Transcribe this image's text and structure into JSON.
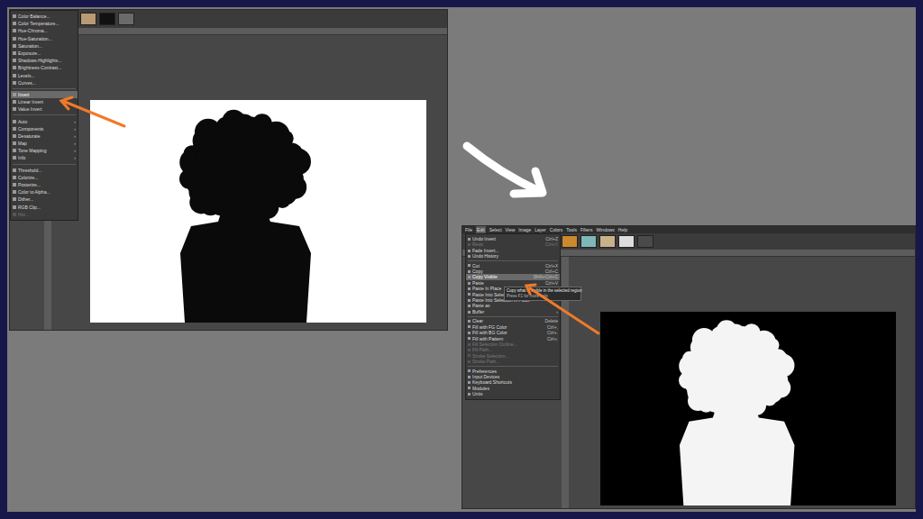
{
  "left_window": {
    "menu": [
      {
        "label": "Color Balance...",
        "kind": "item",
        "selected": false,
        "disabled": false
      },
      {
        "label": "Color Temperature...",
        "kind": "item",
        "selected": false,
        "disabled": false
      },
      {
        "label": "Hue-Chroma...",
        "kind": "item",
        "selected": false,
        "disabled": false
      },
      {
        "label": "Hue-Saturation...",
        "kind": "item",
        "selected": false,
        "disabled": false
      },
      {
        "label": "Saturation...",
        "kind": "item",
        "selected": false,
        "disabled": false
      },
      {
        "label": "Exposure...",
        "kind": "item",
        "selected": false,
        "disabled": false
      },
      {
        "label": "Shadows-Highlights...",
        "kind": "item",
        "selected": false,
        "disabled": false
      },
      {
        "label": "Brightness-Contrast...",
        "kind": "item",
        "selected": false,
        "disabled": false
      },
      {
        "label": "Levels...",
        "kind": "item",
        "selected": false,
        "disabled": false
      },
      {
        "label": "Curves...",
        "kind": "item",
        "selected": false,
        "disabled": false
      },
      {
        "kind": "separator",
        "selected": false,
        "disabled": false
      },
      {
        "label": "Invert",
        "kind": "item",
        "selected": true,
        "disabled": false
      },
      {
        "label": "Linear Invert",
        "kind": "item",
        "selected": false,
        "disabled": false
      },
      {
        "label": "Value Invert",
        "kind": "item",
        "selected": false,
        "disabled": false
      },
      {
        "kind": "separator",
        "selected": false,
        "disabled": false
      },
      {
        "label": "Auto",
        "arrow": "›",
        "kind": "item",
        "selected": false,
        "disabled": false
      },
      {
        "label": "Components",
        "arrow": "›",
        "kind": "item",
        "selected": false,
        "disabled": false
      },
      {
        "label": "Desaturate",
        "arrow": "›",
        "kind": "item",
        "selected": false,
        "disabled": false
      },
      {
        "label": "Map",
        "arrow": "›",
        "kind": "item",
        "selected": false,
        "disabled": false
      },
      {
        "label": "Tone Mapping",
        "arrow": "›",
        "kind": "item",
        "selected": false,
        "disabled": false
      },
      {
        "label": "Info",
        "arrow": "›",
        "kind": "item",
        "selected": false,
        "disabled": false
      },
      {
        "kind": "separator",
        "selected": false,
        "disabled": false
      },
      {
        "label": "Threshold...",
        "kind": "item",
        "selected": false,
        "disabled": false
      },
      {
        "label": "Colorize...",
        "kind": "item",
        "selected": false,
        "disabled": false
      },
      {
        "label": "Posterize...",
        "kind": "item",
        "selected": false,
        "disabled": false
      },
      {
        "label": "Color to Alpha...",
        "kind": "item",
        "selected": false,
        "disabled": false
      },
      {
        "label": "Dither...",
        "kind": "item",
        "selected": false,
        "disabled": false
      },
      {
        "label": "RGB Clip...",
        "kind": "item",
        "selected": false,
        "disabled": false
      },
      {
        "label": "Hot...",
        "kind": "item",
        "selected": false,
        "disabled": true
      }
    ]
  },
  "right_window": {
    "menubar": [
      "File",
      "Edit",
      "Select",
      "View",
      "Image",
      "Layer",
      "Colors",
      "Tools",
      "Filters",
      "Windows",
      "Help"
    ],
    "menu": [
      {
        "label": "Undo Invert",
        "shortcut": "Ctrl+Z",
        "kind": "item",
        "selected": false,
        "disabled": false
      },
      {
        "label": "Redo",
        "shortcut": "Ctrl+Y",
        "kind": "item",
        "selected": false,
        "disabled": true
      },
      {
        "label": "Fade Invert...",
        "kind": "item",
        "selected": false,
        "disabled": false
      },
      {
        "label": "Undo History",
        "kind": "item",
        "selected": false,
        "disabled": false
      },
      {
        "kind": "separator",
        "selected": false,
        "disabled": false
      },
      {
        "label": "Cut",
        "shortcut": "Ctrl+X",
        "kind": "item",
        "selected": false,
        "disabled": false
      },
      {
        "label": "Copy",
        "shortcut": "Ctrl+C",
        "kind": "item",
        "selected": false,
        "disabled": false
      },
      {
        "label": "Copy Visible",
        "shortcut": "Shift+Ctrl+C",
        "kind": "item",
        "selected": true,
        "disabled": false
      },
      {
        "label": "Paste",
        "shortcut": "Ctrl+V",
        "kind": "item",
        "selected": false,
        "disabled": false
      },
      {
        "label": "Paste In Place",
        "kind": "item",
        "selected": false,
        "disabled": false
      },
      {
        "label": "Paste Into Selection",
        "kind": "item",
        "selected": false,
        "disabled": false
      },
      {
        "label": "Paste Into Selection In Place",
        "kind": "item",
        "selected": false,
        "disabled": false
      },
      {
        "label": "Paste as",
        "arrow": "›",
        "kind": "item",
        "selected": false,
        "disabled": false
      },
      {
        "label": "Buffer",
        "arrow": "›",
        "kind": "item",
        "selected": false,
        "disabled": false
      },
      {
        "kind": "separator",
        "selected": false,
        "disabled": false
      },
      {
        "label": "Clear",
        "shortcut": "Delete",
        "kind": "item",
        "selected": false,
        "disabled": false
      },
      {
        "label": "Fill with FG Color",
        "shortcut": "Ctrl+,",
        "kind": "item",
        "selected": false,
        "disabled": false
      },
      {
        "label": "Fill with BG Color",
        "shortcut": "Ctrl+.",
        "kind": "item",
        "selected": false,
        "disabled": false
      },
      {
        "label": "Fill with Pattern",
        "shortcut": "Ctrl+;",
        "kind": "item",
        "selected": false,
        "disabled": false
      },
      {
        "label": "Fill Selection Outline...",
        "kind": "item",
        "selected": false,
        "disabled": true
      },
      {
        "label": "Fill Path...",
        "kind": "item",
        "selected": false,
        "disabled": true
      },
      {
        "label": "Stroke Selection...",
        "kind": "item",
        "selected": false,
        "disabled": true
      },
      {
        "label": "Stroke Path...",
        "kind": "item",
        "selected": false,
        "disabled": true
      },
      {
        "kind": "separator",
        "selected": false,
        "disabled": false
      },
      {
        "label": "Preferences",
        "kind": "item",
        "selected": false,
        "disabled": false
      },
      {
        "label": "Input Devices",
        "kind": "item",
        "selected": false,
        "disabled": false
      },
      {
        "label": "Keyboard Shortcuts",
        "kind": "item",
        "selected": false,
        "disabled": false
      },
      {
        "label": "Modules",
        "kind": "item",
        "selected": false,
        "disabled": false
      },
      {
        "label": "Units",
        "kind": "item",
        "selected": false,
        "disabled": false
      }
    ],
    "tooltip": {
      "text": "Copy what is visible in the selected region",
      "help": "Press F1 for more help"
    }
  }
}
